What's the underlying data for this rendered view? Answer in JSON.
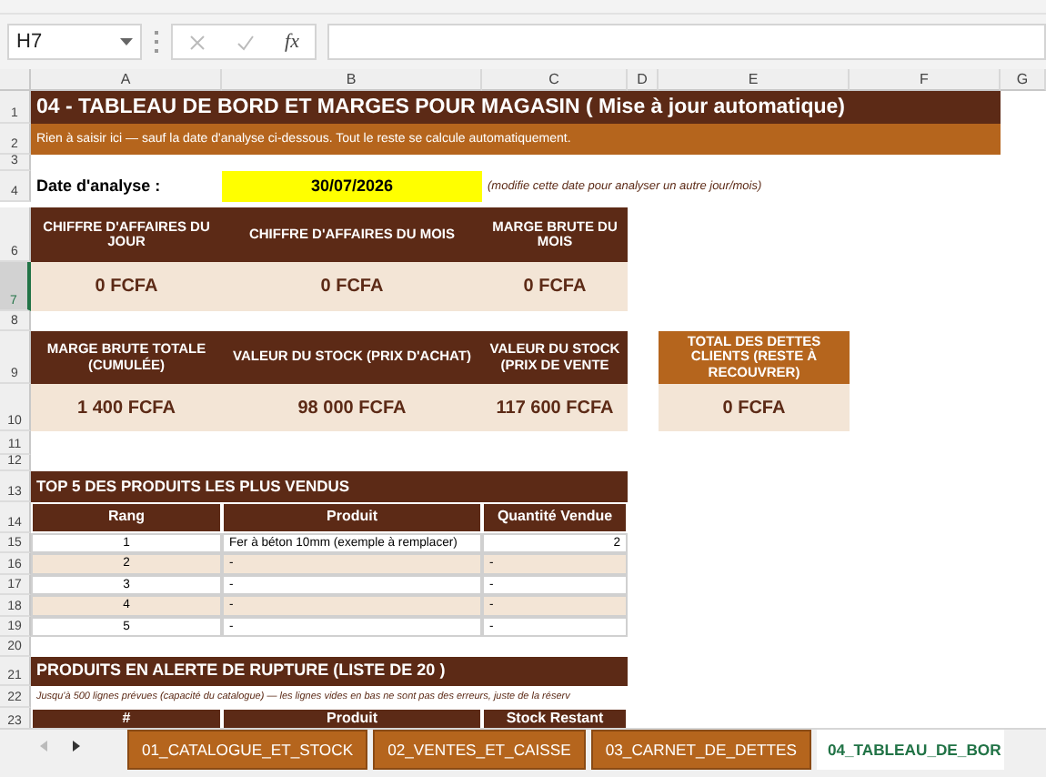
{
  "formula_bar": {
    "name_box": "H7",
    "function_label": "fx"
  },
  "column_letters": [
    "A",
    "B",
    "C",
    "D",
    "E",
    "F",
    "G"
  ],
  "row_numbers": [
    {
      "label": "1",
      "selected": false
    },
    {
      "label": "2",
      "selected": false
    },
    {
      "label": "3",
      "selected": false
    },
    {
      "label": "4",
      "selected": false
    },
    {
      "label": "6",
      "selected": false
    },
    {
      "label": "7",
      "selected": true
    },
    {
      "label": "8",
      "selected": false
    },
    {
      "label": "9",
      "selected": false
    },
    {
      "label": "10",
      "selected": false
    },
    {
      "label": "11",
      "selected": false
    },
    {
      "label": "12",
      "selected": false
    },
    {
      "label": "13",
      "selected": false
    },
    {
      "label": "14",
      "selected": false
    },
    {
      "label": "15",
      "selected": false
    },
    {
      "label": "16",
      "selected": false
    },
    {
      "label": "17",
      "selected": false
    },
    {
      "label": "18",
      "selected": false
    },
    {
      "label": "19",
      "selected": false
    },
    {
      "label": "20",
      "selected": false
    },
    {
      "label": "21",
      "selected": false
    },
    {
      "label": "22",
      "selected": false
    },
    {
      "label": "23",
      "selected": false
    }
  ],
  "title": "04 - TABLEAU DE BORD ET MARGES POUR MAGASIN ( Mise à jour automatique)",
  "subtitle": "Rien à saisir ici — sauf la date d'analyse ci-dessous. Tout le reste se calcule automatiquement.",
  "date_label": "Date d'analyse :",
  "date_value": "30/07/2026",
  "date_hint": "(modifie cette date pour analyser un autre jour/mois)",
  "kpis_row_1": [
    {
      "label": "CHIFFRE D'AFFAIRES DU JOUR",
      "value": "0 FCFA",
      "kind": "main"
    },
    {
      "label": "CHIFFRE D'AFFAIRES DU MOIS",
      "value": "0 FCFA",
      "kind": "main"
    },
    {
      "label": "MARGE BRUTE DU MOIS",
      "value": "0 FCFA",
      "kind": "main"
    }
  ],
  "kpis_row_2": [
    {
      "label": "MARGE BRUTE TOTALE (CUMULÉE)",
      "value": "1 400 FCFA",
      "kind": "main"
    },
    {
      "label": "VALEUR DU STOCK (PRIX D'ACHAT)",
      "value": "98 000 FCFA",
      "kind": "main"
    },
    {
      "label": "VALEUR DU STOCK (PRIX DE VENTE",
      "value": "117 600 FCFA",
      "kind": "main"
    },
    {
      "label": "TOTAL DES DETTES CLIENTS (RESTE À RECOUVRER)",
      "value": "0 FCFA",
      "kind": "debt"
    }
  ],
  "top5": {
    "title": "TOP 5 DES PRODUITS LES PLUS VENDUS",
    "columns": [
      "Rang",
      "Produit",
      "Quantité Vendue"
    ],
    "rows": [
      [
        "1",
        "Fer à béton 10mm (exemple à remplacer)",
        "2"
      ],
      [
        "2",
        "-",
        "-"
      ],
      [
        "3",
        "-",
        "-"
      ],
      [
        "4",
        "-",
        "-"
      ],
      [
        "5",
        "-",
        "-"
      ]
    ]
  },
  "alerts": {
    "title": "PRODUITS EN ALERTE DE RUPTURE (LISTE DE 20 )",
    "note": "Jusqu'à 500 lignes prévues (capacité du catalogue) — les lignes vides en bas ne sont pas des erreurs, juste de la réserv",
    "columns": [
      "#",
      "Produit",
      "Stock Restant"
    ]
  },
  "sheet_tabs": [
    {
      "label": "01_CATALOGUE_ET_STOCK",
      "selected": false
    },
    {
      "label": "02_VENTES_ET_CAISSE",
      "selected": false
    },
    {
      "label": "03_CARNET_DE_DETTES",
      "selected": false
    },
    {
      "label": "04_TABLEAU_DE_BOR",
      "selected": true
    }
  ]
}
